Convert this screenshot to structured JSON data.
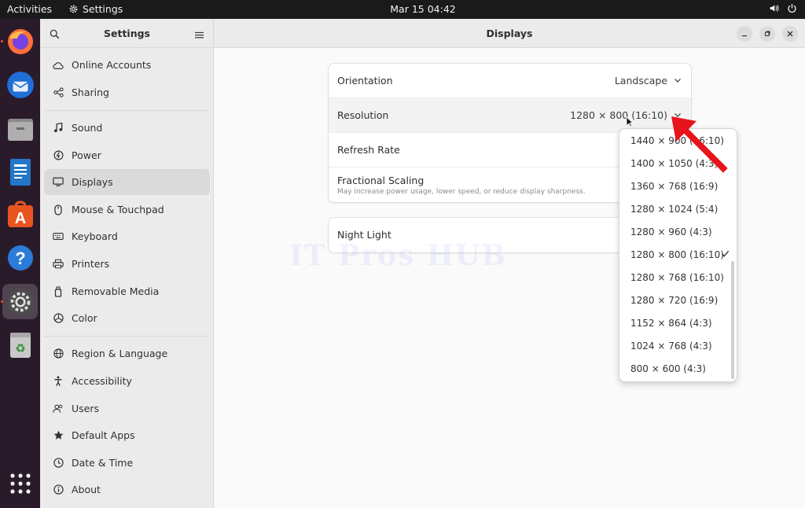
{
  "topbar": {
    "activities": "Activities",
    "app_name": "Settings",
    "clock": "Mar 15  04:42"
  },
  "dock": {
    "items": [
      "firefox-icon",
      "thunderbird-icon",
      "files-icon",
      "libreoffice-writer-icon",
      "app-center-icon",
      "help-icon",
      "settings-icon",
      "trash-icon",
      "show-apps-icon"
    ]
  },
  "sidebar": {
    "title": "Settings",
    "items": [
      {
        "label": "Online Accounts",
        "icon": "cloud-icon"
      },
      {
        "label": "Sharing",
        "icon": "share-icon"
      },
      {
        "label": "Sound",
        "icon": "music-note-icon"
      },
      {
        "label": "Power",
        "icon": "power-icon"
      },
      {
        "label": "Displays",
        "icon": "monitor-icon"
      },
      {
        "label": "Mouse & Touchpad",
        "icon": "mouse-icon"
      },
      {
        "label": "Keyboard",
        "icon": "keyboard-icon"
      },
      {
        "label": "Printers",
        "icon": "printer-icon"
      },
      {
        "label": "Removable Media",
        "icon": "usb-icon"
      },
      {
        "label": "Color",
        "icon": "color-icon"
      },
      {
        "label": "Region & Language",
        "icon": "globe-icon"
      },
      {
        "label": "Accessibility",
        "icon": "accessibility-icon"
      },
      {
        "label": "Users",
        "icon": "users-icon"
      },
      {
        "label": "Default Apps",
        "icon": "star-icon"
      },
      {
        "label": "Date & Time",
        "icon": "clock-icon"
      },
      {
        "label": "About",
        "icon": "info-icon"
      }
    ],
    "selected": "Displays"
  },
  "main": {
    "title": "Displays",
    "rows": {
      "orientation": {
        "label": "Orientation",
        "value": "Landscape"
      },
      "resolution": {
        "label": "Resolution",
        "value": "1280 × 800 (16:10)"
      },
      "refresh_rate": {
        "label": "Refresh Rate"
      },
      "fractional_scaling": {
        "label": "Fractional Scaling",
        "sub": "May increase power usage, lower speed, or reduce display sharpness."
      },
      "night_light": {
        "label": "Night Light"
      }
    }
  },
  "resolution_dropdown": {
    "options": [
      "1440 × 900 (16:10)",
      "1400 × 1050 (4:3)",
      "1360 × 768 (16:9)",
      "1280 × 1024 (5:4)",
      "1280 × 960 (4:3)",
      "1280 × 800 (16:10)",
      "1280 × 768 (16:10)",
      "1280 × 720 (16:9)",
      "1152 × 864 (4:3)",
      "1024 × 768 (4:3)",
      "800 × 600 (4:3)"
    ],
    "selected": "1280 × 800 (16:10)"
  },
  "watermark": "IT Pros HUB",
  "colors": {
    "accent": "#e95420",
    "annotation_arrow": "#e8141b"
  }
}
